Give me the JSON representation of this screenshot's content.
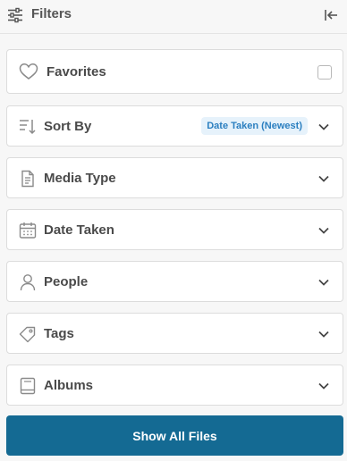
{
  "header": {
    "title": "Filters"
  },
  "favorites": {
    "label": "Favorites",
    "checked": false
  },
  "sort_by": {
    "label": "Sort By",
    "value_badge": "Date Taken (Newest)"
  },
  "sections": [
    {
      "label": "Media Type",
      "icon": "document-icon"
    },
    {
      "label": "Date Taken",
      "icon": "calendar-icon"
    },
    {
      "label": "People",
      "icon": "person-icon"
    },
    {
      "label": "Tags",
      "icon": "tag-icon"
    },
    {
      "label": "Albums",
      "icon": "album-icon"
    }
  ],
  "footer": {
    "show_all_label": "Show All Files"
  },
  "colors": {
    "primary_button": "#146a93",
    "badge_text": "#2b7fc0",
    "badge_bg": "#e6f2fb"
  }
}
